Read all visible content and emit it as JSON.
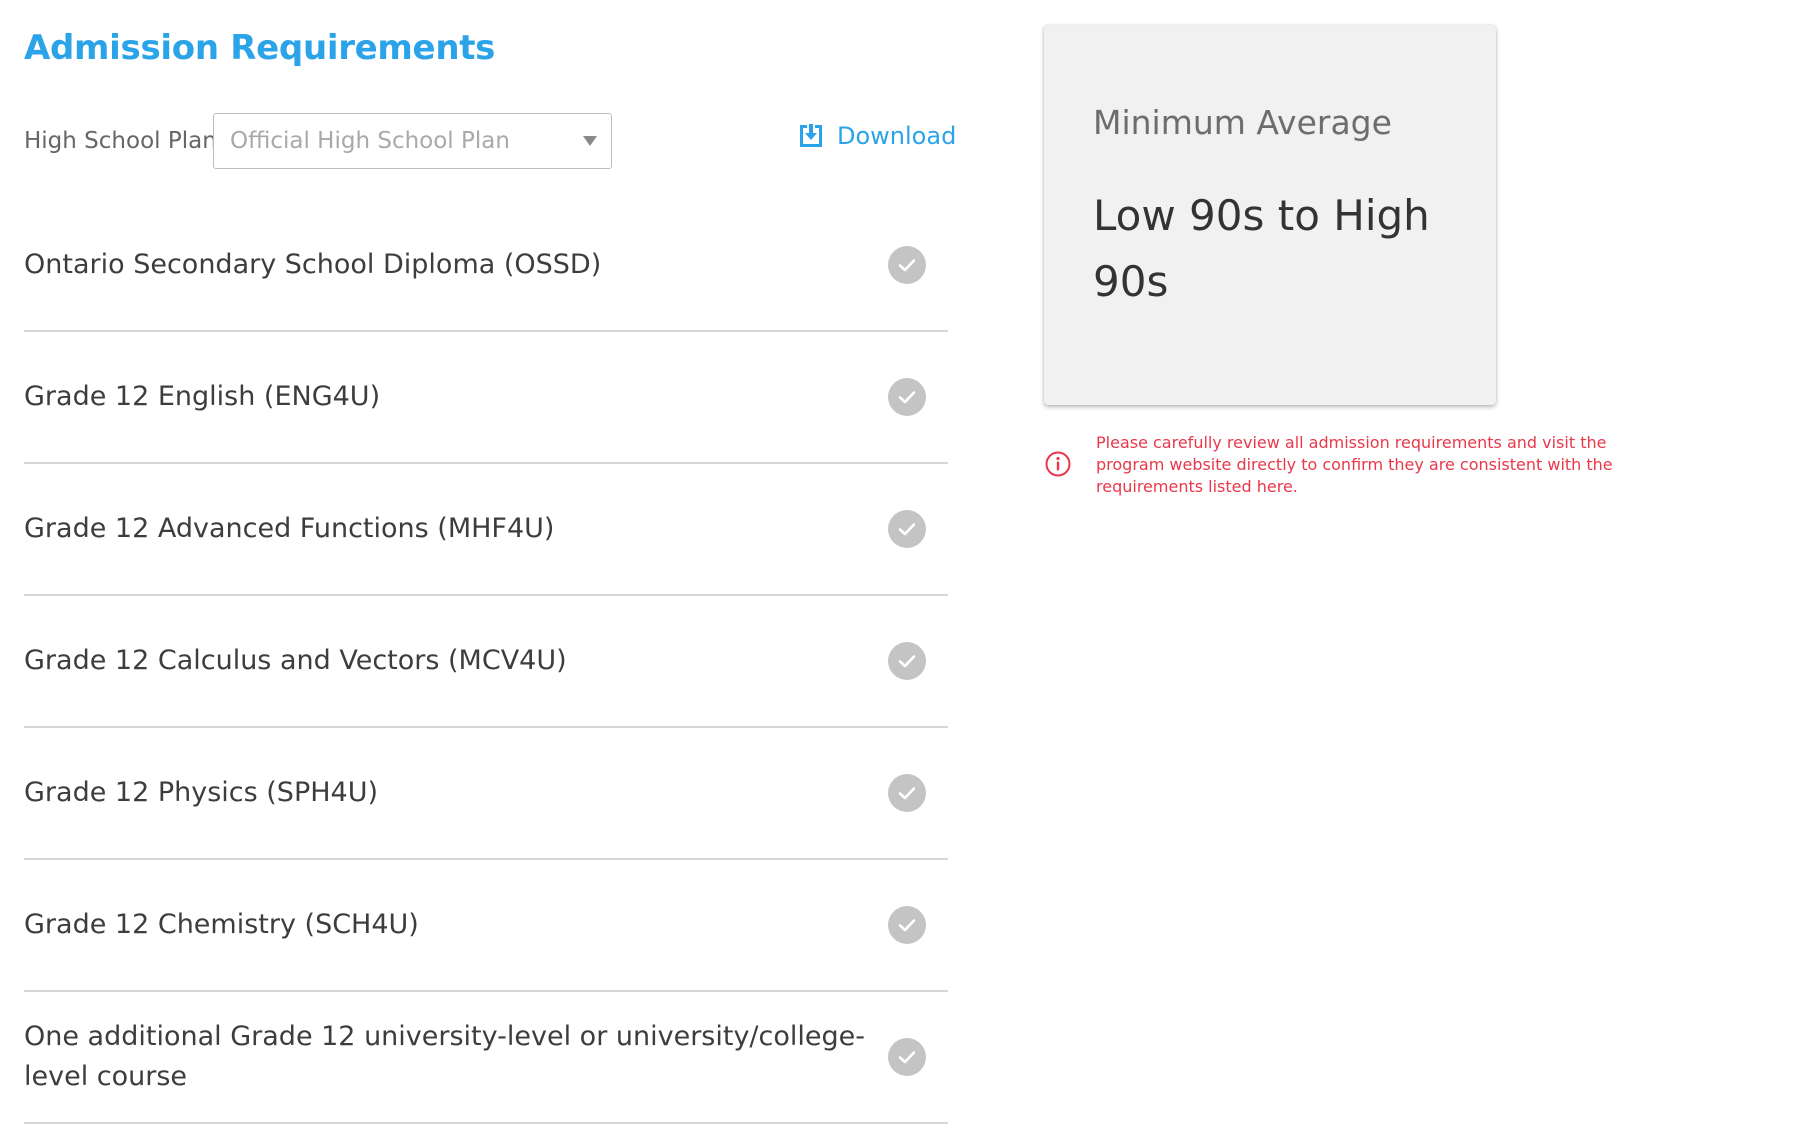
{
  "header": {
    "title": "Admission Requirements"
  },
  "plan": {
    "label": "High School Plan",
    "selected": "Official High School Plan"
  },
  "download": {
    "label": "Download"
  },
  "requirements": [
    {
      "label": "Ontario Secondary School Diploma (OSSD)"
    },
    {
      "label": "Grade 12 English (ENG4U)"
    },
    {
      "label": "Grade 12 Advanced Functions (MHF4U)"
    },
    {
      "label": "Grade 12 Calculus and Vectors (MCV4U)"
    },
    {
      "label": "Grade 12 Physics (SPH4U)"
    },
    {
      "label": "Grade 12 Chemistry (SCH4U)"
    },
    {
      "label": "One additional Grade 12 university-level or university/college-level course"
    }
  ],
  "average": {
    "label": "Minimum Average",
    "value": "Low 90s to High 90s"
  },
  "notice": {
    "text": "Please carefully review all admission requirements and visit the program website directly to confirm they are consistent with the requirements listed here."
  },
  "colors": {
    "accent": "#2ba3e8",
    "warning": "#e8384a",
    "check": "#c4c4c4"
  }
}
